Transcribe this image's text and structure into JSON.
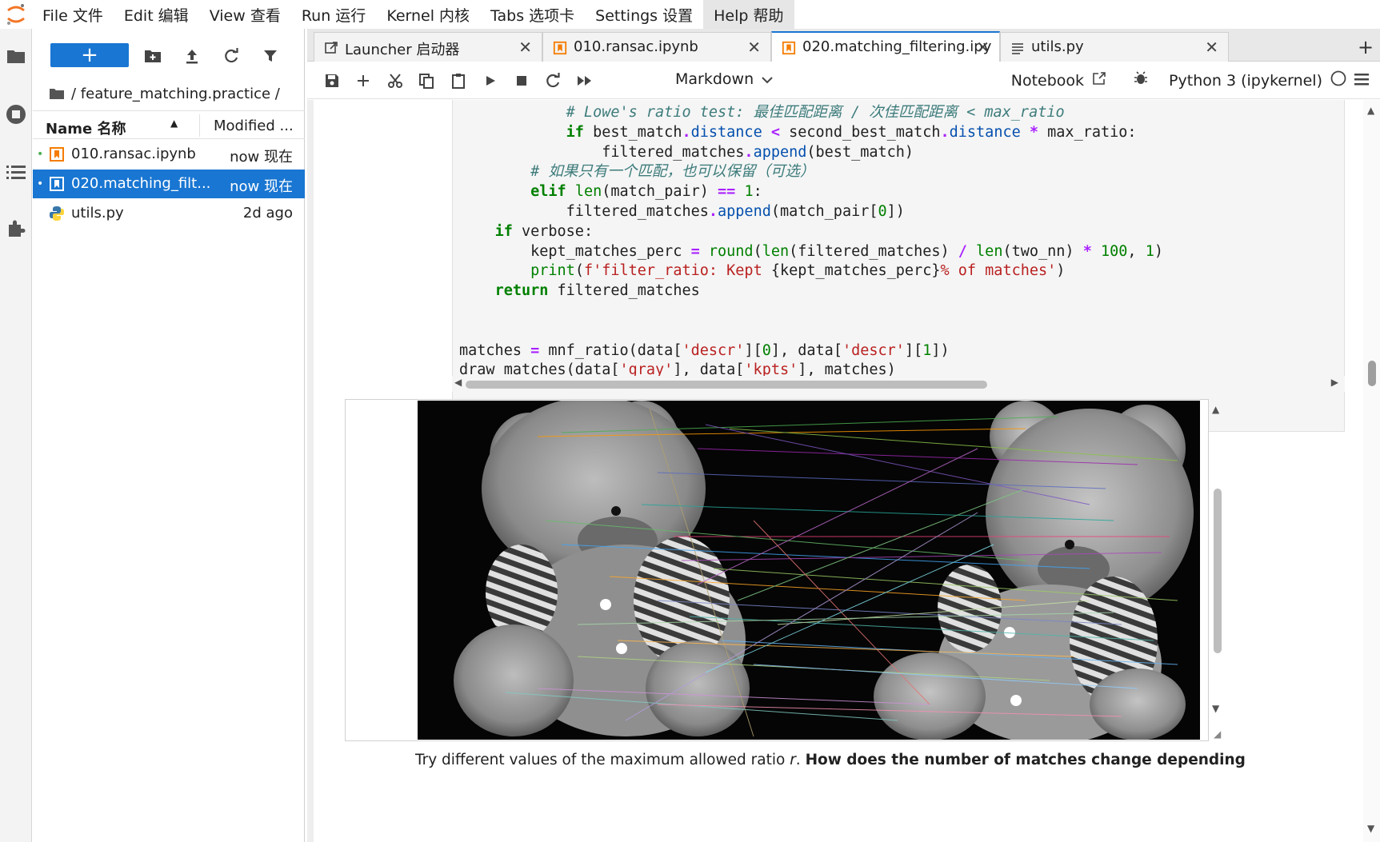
{
  "menubar": {
    "items": [
      {
        "label": "File 文件"
      },
      {
        "label": "Edit 编辑"
      },
      {
        "label": "View 查看"
      },
      {
        "label": "Run 运行"
      },
      {
        "label": "Kernel 内核"
      },
      {
        "label": "Tabs 选项卡"
      },
      {
        "label": "Settings 设置"
      },
      {
        "label": "Help 帮助"
      }
    ]
  },
  "filebrowser": {
    "new_label": "+",
    "breadcrumb": "/ feature_matching.practice /",
    "header_name": "Name 名称",
    "header_modified": "Modified ...",
    "files": [
      {
        "name": "010.ransac.ipynb",
        "modified": "now 现在",
        "icon": "notebook-icon"
      },
      {
        "name": "020.matching_filt...",
        "modified": "now 现在",
        "icon": "notebook-icon"
      },
      {
        "name": "utils.py",
        "modified": "2d ago",
        "icon": "python-icon"
      }
    ]
  },
  "tabs": [
    {
      "label": "Launcher 启动器",
      "icon": "launcher-icon"
    },
    {
      "label": "010.ransac.ipynb",
      "icon": "notebook-icon"
    },
    {
      "label": "020.matching_filtering.ipy",
      "icon": "notebook-icon"
    },
    {
      "label": "utils.py",
      "icon": "file-icon"
    }
  ],
  "toolbar": {
    "cell_type": "Markdown",
    "notebook_label": "Notebook",
    "kernel_name": "Python 3 (ipykernel)"
  },
  "markdown_text_start": "Try different values of the maximum allowed ratio ",
  "markdown_text_var": "r",
  "markdown_text_bold": "How does the number of matches change depending",
  "colors": {
    "accent": "#1976d2",
    "notebook_orange": "#f57c00"
  }
}
